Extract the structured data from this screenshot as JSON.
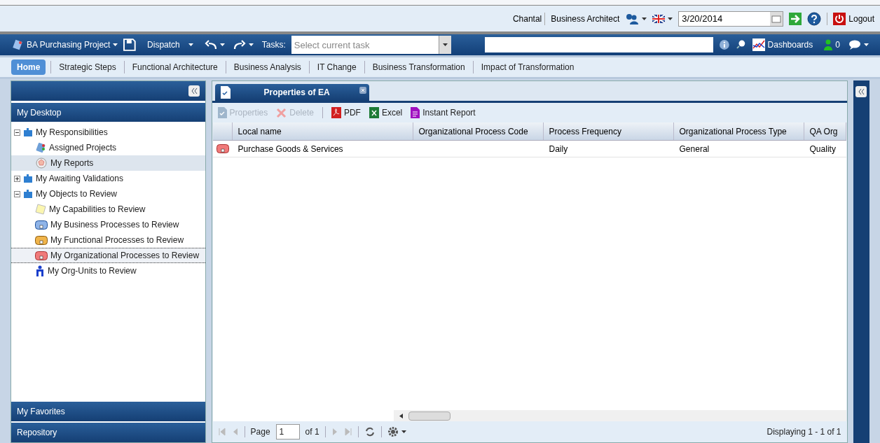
{
  "header": {
    "user": "Chantal",
    "role": "Business Architect",
    "date": "3/20/2014",
    "logout": "Logout"
  },
  "toolbar": {
    "project": "BA Purchasing Project",
    "dispatch": "Dispatch",
    "tasks_label": "Tasks:",
    "task_placeholder": "Select current task",
    "dashboards": "Dashboards",
    "notifications": "0"
  },
  "nav_tabs": [
    {
      "label": "Home",
      "selected": true
    },
    {
      "label": "Strategic Steps",
      "selected": false
    },
    {
      "label": "Functional Architecture",
      "selected": false
    },
    {
      "label": "Business Analysis",
      "selected": false
    },
    {
      "label": "IT Change",
      "selected": false
    },
    {
      "label": "Business Transformation",
      "selected": false
    },
    {
      "label": "Impact of Transformation",
      "selected": false
    }
  ],
  "sidebar": {
    "title": "My Desktop",
    "tree": [
      {
        "label": "My Responsibilities",
        "kind": "folder",
        "expanded": true,
        "selected": false,
        "hovered": false,
        "children": [
          {
            "label": "Assigned Projects",
            "kind": "projects",
            "selected": false,
            "hovered": false
          },
          {
            "label": "My Reports",
            "kind": "report",
            "selected": false,
            "hovered": true
          }
        ]
      },
      {
        "label": "My Awaiting Validations",
        "kind": "folder",
        "expanded": false,
        "selected": false,
        "hovered": false
      },
      {
        "label": "My Objects to Review",
        "kind": "folder",
        "expanded": true,
        "selected": false,
        "hovered": false,
        "children": [
          {
            "label": "My Capabilities to Review",
            "kind": "capability",
            "selected": false,
            "hovered": false
          },
          {
            "label": "My Business Processes to Review",
            "kind": "business",
            "selected": false,
            "hovered": false
          },
          {
            "label": "My Functional Processes to Review",
            "kind": "functional",
            "selected": false,
            "hovered": false
          },
          {
            "label": "My Organizational Processes to Review",
            "kind": "organizational",
            "selected": true,
            "hovered": false
          },
          {
            "label": "My Org-Units to Review",
            "kind": "orgunit",
            "selected": false,
            "hovered": false
          }
        ]
      }
    ],
    "sections": [
      "My Favorites",
      "Repository"
    ]
  },
  "document_tab": {
    "title": "Properties of EA"
  },
  "actions": [
    {
      "label": "Properties",
      "kind": "properties",
      "disabled": true
    },
    {
      "label": "Delete",
      "kind": "delete",
      "disabled": true
    },
    {
      "label": "PDF",
      "kind": "pdf",
      "disabled": false
    },
    {
      "label": "Excel",
      "kind": "excel",
      "disabled": false
    },
    {
      "label": "Instant Report",
      "kind": "report",
      "disabled": false
    }
  ],
  "table": {
    "columns": [
      "Local name",
      "Organizational Process Code",
      "Process Frequency",
      "Organizational Process Type",
      "QA Org"
    ],
    "rows": [
      [
        "Purchase Goods & Services",
        "",
        "Daily",
        "General",
        "Quality"
      ]
    ]
  },
  "pager": {
    "page_label": "Page",
    "page": "1",
    "of": "of 1",
    "displaying": "Displaying 1 - 1 of 1"
  }
}
